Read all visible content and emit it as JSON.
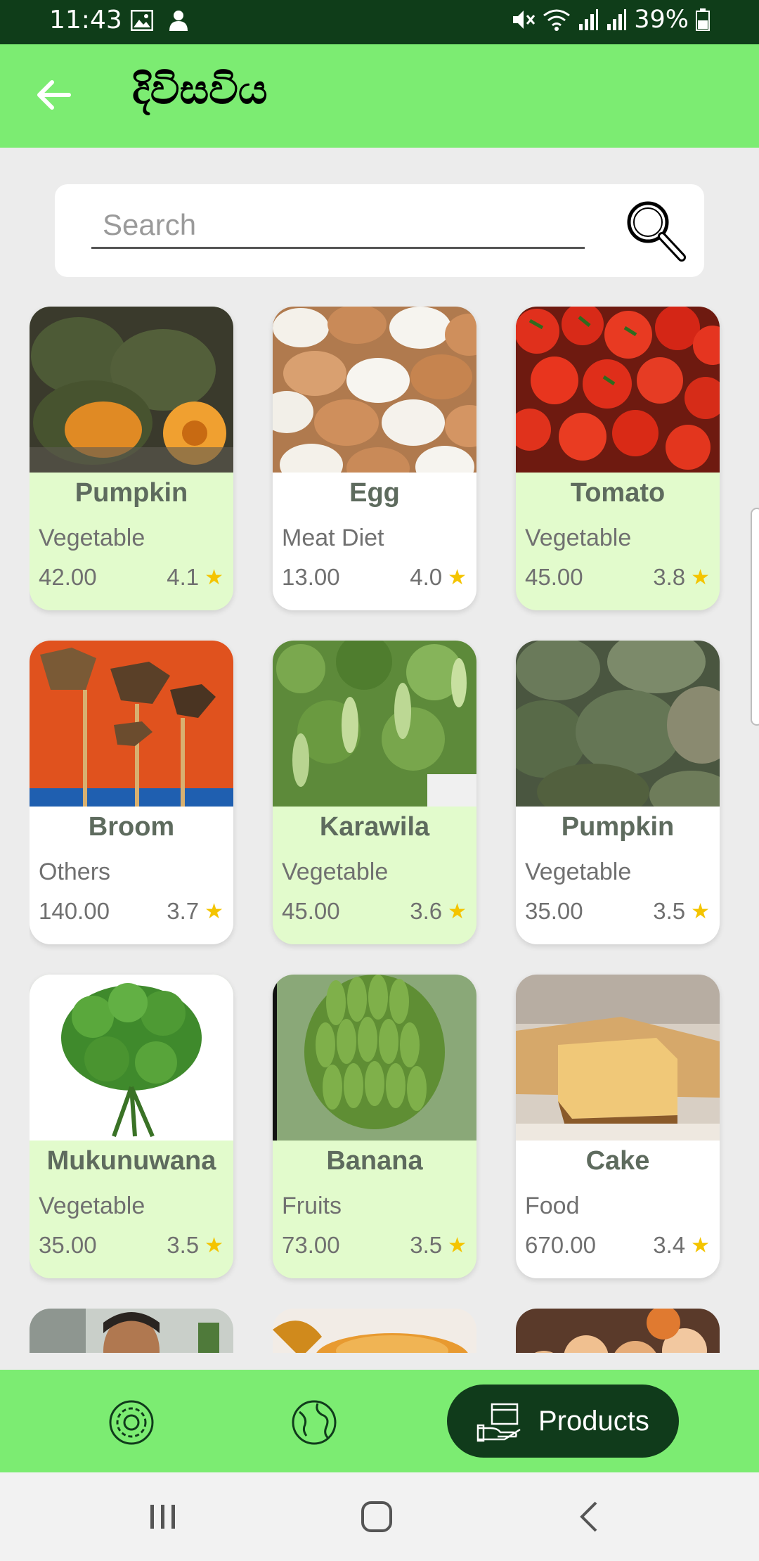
{
  "status_bar": {
    "time": "11:43",
    "battery": "39%",
    "icons": [
      "image-icon",
      "person-icon",
      "mute-icon",
      "wifi-icon",
      "signal-icon",
      "signal-icon",
      "battery-icon"
    ]
  },
  "app_bar": {
    "title": "දිවිසවිය",
    "back_icon": "arrow-left-icon"
  },
  "search": {
    "placeholder": "Search",
    "value": "",
    "icon": "magnifier-icon"
  },
  "products": [
    {
      "name": "Pumpkin",
      "category": "Vegetable",
      "price": "42.00",
      "rating": "4.1",
      "highlight": true,
      "image": "pumpkin"
    },
    {
      "name": "Egg",
      "category": "Meat Diet",
      "price": "13.00",
      "rating": "4.0",
      "highlight": false,
      "image": "egg"
    },
    {
      "name": "Tomato",
      "category": "Vegetable",
      "price": "45.00",
      "rating": "3.8",
      "highlight": true,
      "image": "tomato"
    },
    {
      "name": "Broom",
      "category": "Others",
      "price": "140.00",
      "rating": "3.7",
      "highlight": false,
      "image": "broom"
    },
    {
      "name": "Karawila",
      "category": "Vegetable",
      "price": "45.00",
      "rating": "3.6",
      "highlight": true,
      "image": "karawila"
    },
    {
      "name": "Pumpkin",
      "category": "Vegetable",
      "price": "35.00",
      "rating": "3.5",
      "highlight": false,
      "image": "pumpkin2"
    },
    {
      "name": "Mukunuwana",
      "category": "Vegetable",
      "price": "35.00",
      "rating": "3.5",
      "highlight": true,
      "image": "greens"
    },
    {
      "name": "Banana",
      "category": "Fruits",
      "price": "73.00",
      "rating": "3.5",
      "highlight": true,
      "image": "banana"
    },
    {
      "name": "Cake",
      "category": "Food",
      "price": "670.00",
      "rating": "3.4",
      "highlight": false,
      "image": "cake"
    }
  ],
  "bottom_nav": {
    "items": [
      {
        "icon": "settings-gear-icon"
      },
      {
        "icon": "globe-icon"
      },
      {
        "icon": "products-box-icon",
        "label": "Products",
        "active": true
      }
    ]
  },
  "colors": {
    "app_bar": "#7cec72",
    "status_bar": "#0f3d19",
    "card_highlight": "#e2fbcc",
    "active_pill": "#103b1b",
    "star": "#f4c400"
  }
}
